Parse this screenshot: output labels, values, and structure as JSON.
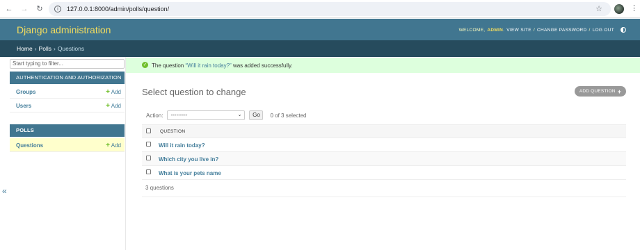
{
  "browser": {
    "url": "127.0.0.1:8000/admin/polls/question/",
    "back_glyph": "←",
    "forward_glyph": "→",
    "reload_glyph": "↻",
    "info_glyph": "i",
    "star_glyph": "☆",
    "menu_glyph": "⋮"
  },
  "header": {
    "brand": "Django administration",
    "welcome": "WELCOME,",
    "username": "ADMIN",
    "tail": ".",
    "view_site": "VIEW SITE",
    "sep1": "/",
    "change_password": "CHANGE PASSWORD",
    "sep2": "/",
    "log_out": "LOG OUT"
  },
  "breadcrumbs": {
    "home": "Home",
    "sep1": "›",
    "polls": "Polls",
    "sep2": "›",
    "current": "Questions"
  },
  "sidebar": {
    "filter_placeholder": "Start typing to filter...",
    "auth_caption": "Authentication and Authorization",
    "auth_models": [
      {
        "name": "Groups",
        "add": "Add"
      },
      {
        "name": "Users",
        "add": "Add"
      }
    ],
    "polls_caption": "Polls",
    "polls_models": [
      {
        "name": "Questions",
        "add": "Add"
      }
    ],
    "plus_glyph": "+",
    "collapse_glyph": "«"
  },
  "message": {
    "icon_glyph": "✓",
    "prefix": "The question ",
    "link": "“Will it rain today?”",
    "suffix": " was added successfully."
  },
  "content": {
    "title": "Select question to change",
    "add_button": "Add question",
    "add_plus": "+",
    "action_label": "Action:",
    "action_value": "---------",
    "action_caret": "⌄",
    "go": "Go",
    "selected": "0 of 3 selected",
    "column_header": "Question",
    "rows": [
      "Will it rain today?",
      "Which city you live in?",
      "What is your pets name"
    ],
    "paginator": "3 questions"
  }
}
